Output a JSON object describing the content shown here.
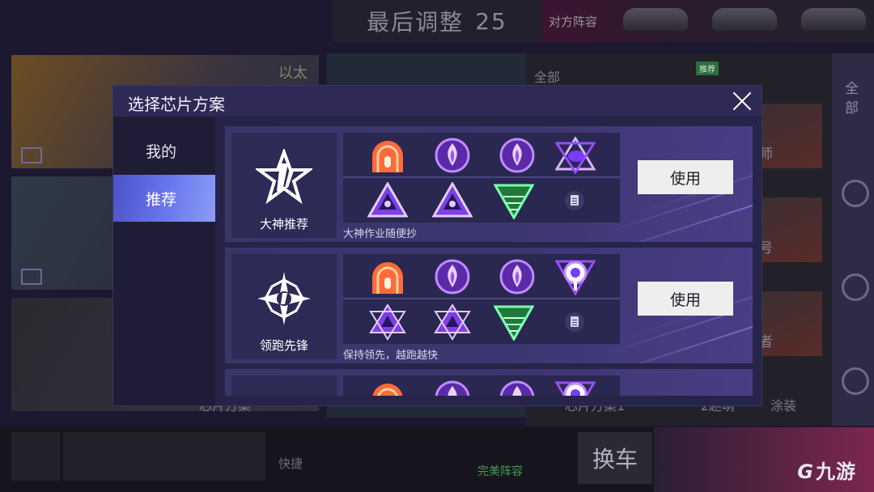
{
  "background": {
    "top_title": "最后调整",
    "countdown": "25",
    "enemy_lineup_label": "对方阵容",
    "card_tag": "以太",
    "filter_all": "全部",
    "side_all_label": "全部",
    "right_card_labels": [
      "师",
      "号",
      "者"
    ],
    "bottom_labels": [
      "芯片方案",
      "芯片方案1",
      "2赵萌",
      "涂装"
    ],
    "quick_label": "快捷",
    "swap_car_label": "换车",
    "perfect_lineup_label": "完美阵容",
    "recommend_badge": "推荐"
  },
  "watermark": {
    "glyph": "G",
    "text": "九游"
  },
  "dialog": {
    "title": "选择芯片方案",
    "tabs": [
      {
        "label": "我的",
        "active": false
      },
      {
        "label": "推荐",
        "active": true
      }
    ],
    "use_label": "使用",
    "plans": [
      {
        "name": "大神推荐",
        "desc": "大神作业随便抄",
        "emblem": "star-split-emblem",
        "chips_top": [
          "orange-dome-chip",
          "purple-flame-chip",
          "purple-flame-chip",
          "purple-star-wing-chip"
        ],
        "chips_bottom": [
          "purple-triangle-chip",
          "purple-triangle-chip",
          "green-tree-chip",
          "document-icon"
        ]
      },
      {
        "name": "领跑先锋",
        "desc": "保持领先，越跑越快",
        "emblem": "compass-star-emblem",
        "chips_top": [
          "orange-dome-chip",
          "purple-flame-chip",
          "purple-flame-chip",
          "purple-target-chip"
        ],
        "chips_bottom": [
          "purple-hexagram-chip",
          "purple-hexagram-chip",
          "green-tree-chip",
          "document-icon"
        ]
      },
      {
        "name": "",
        "desc": "",
        "emblem": "",
        "chips_top": [
          "orange-dome-chip",
          "purple-flame-chip",
          "purple-flame-chip",
          "purple-target-chip"
        ],
        "chips_bottom": []
      }
    ]
  },
  "colors": {
    "dialog_bg": "#27244a",
    "tab_active": "#6a78ee",
    "chip_purple": "#9b4dff",
    "chip_orange": "#ff6a3a",
    "chip_green": "#3fd46a"
  }
}
